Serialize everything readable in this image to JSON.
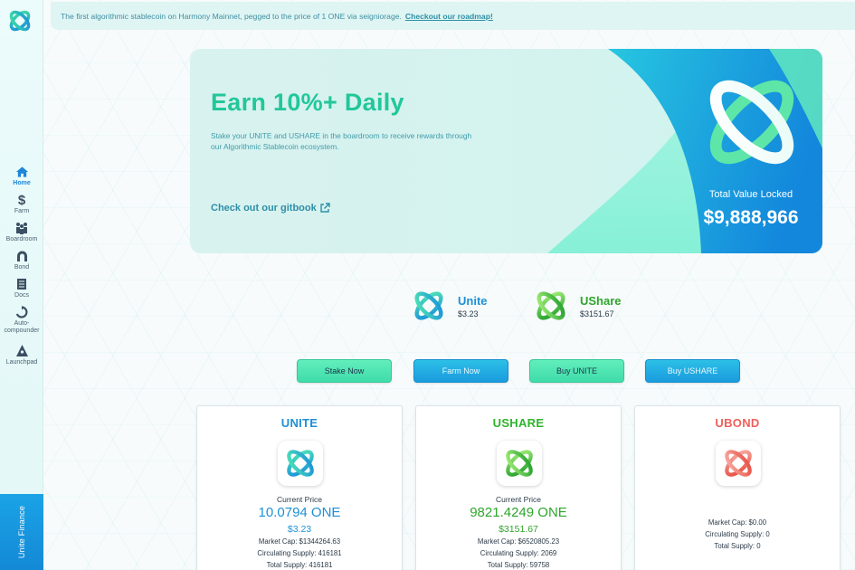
{
  "colors": {
    "accent_green": "#22c79a",
    "accent_blue": "#1a9bde",
    "unite_blue": "#1d90d6",
    "ushare_green": "#2fb42b",
    "ubond_red": "#f0605a"
  },
  "announcement": {
    "text": "The first algorithmic stablecoin on Harmony Mainnet, pegged to the price of 1 ONE via seigniorage.",
    "link": "Checkout our roadmap!"
  },
  "sidebar": {
    "items": [
      {
        "label": "Home",
        "icon": "home-icon"
      },
      {
        "label": "Farm",
        "icon": "dollar-icon"
      },
      {
        "label": "Boardroom",
        "icon": "people-icon"
      },
      {
        "label": "Bond",
        "icon": "bond-icon"
      },
      {
        "label": "Docs",
        "icon": "docs-icon"
      },
      {
        "label": "Auto-compounder",
        "icon": "refresh-icon"
      },
      {
        "label": "Launchpad",
        "icon": "launchpad-icon"
      }
    ],
    "brand": "Unite Finance"
  },
  "hero": {
    "title": "Earn 10%+ Daily",
    "description": "Stake your UNITE and USHARE in the boardroom to receive rewards through our Algorithmic Stablecoin ecosystem.",
    "link": "Check out our gitbook",
    "tvl_label": "Total Value Locked",
    "tvl_value": "$9,888,966"
  },
  "tokens": [
    {
      "name": "Unite",
      "price": "$3.23"
    },
    {
      "name": "UShare",
      "price": "$3151.67"
    }
  ],
  "buttons": {
    "stake": "Stake Now",
    "farm": "Farm Now",
    "buy_unite": "Buy UNITE",
    "buy_ushare": "Buy USHARE"
  },
  "cards": {
    "unite": {
      "title": "UNITE",
      "price_label": "Current Price",
      "price_one": "10.0794 ONE",
      "price_usd": "$3.23",
      "market_cap": "Market Cap: $1344264.63",
      "circulating": "Circulating Supply: 416181",
      "total": "Total Supply: 416181"
    },
    "ushare": {
      "title": "USHARE",
      "price_label": "Current Price",
      "price_one": "9821.4249 ONE",
      "price_usd": "$3151.67",
      "market_cap": "Market Cap: $6520805.23",
      "circulating": "Circulating Supply: 2069",
      "total": "Total Supply: 59758"
    },
    "ubond": {
      "title": "UBOND",
      "market_cap": "Market Cap: $0.00",
      "circulating": "Circulating Supply: 0",
      "total": "Total Supply: 0"
    }
  }
}
